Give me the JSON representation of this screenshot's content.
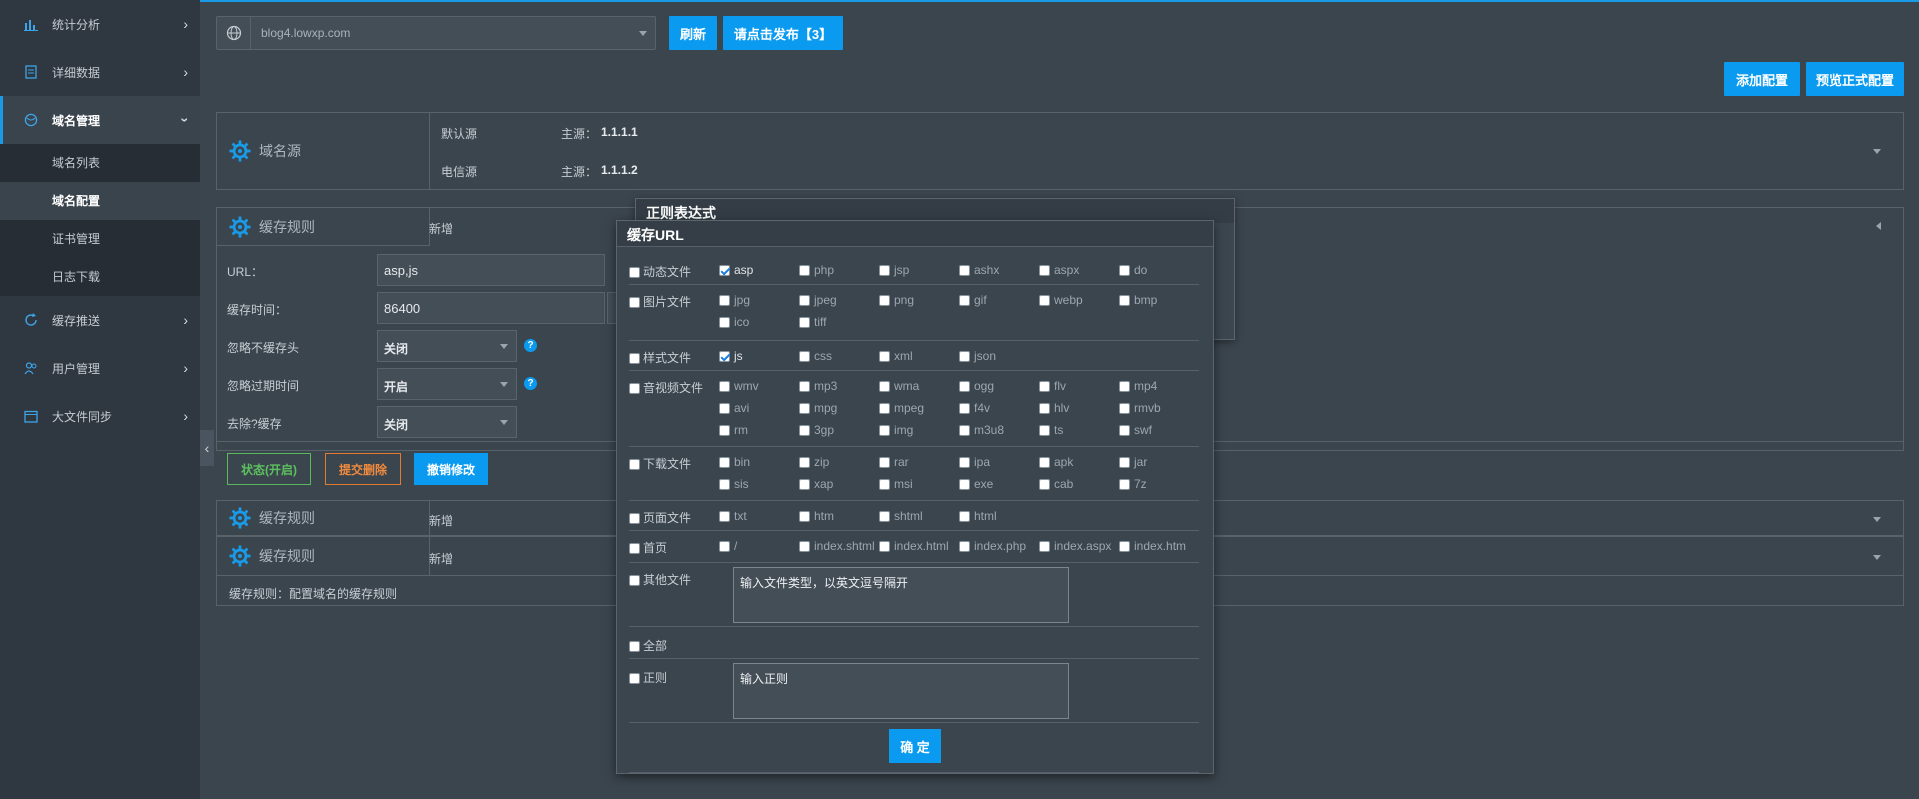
{
  "sidebar": {
    "items": [
      {
        "label": "统计分析",
        "icon": "bar-chart-icon"
      },
      {
        "label": "详细数据",
        "icon": "document-icon"
      },
      {
        "label": "域名管理",
        "icon": "globe-icon"
      },
      {
        "label": "缓存推送",
        "icon": "refresh-icon"
      },
      {
        "label": "用户管理",
        "icon": "users-icon"
      },
      {
        "label": "大文件同步",
        "icon": "calendar-icon"
      }
    ],
    "sub_items": [
      "域名列表",
      "域名配置",
      "证书管理",
      "日志下载"
    ]
  },
  "toolbar": {
    "domain": "blog4.lowxp.com",
    "refresh": "刷新",
    "publish": "请点击发布【3】",
    "add_config": "添加配置",
    "preview_config": "预览正式配置"
  },
  "origin_panel": {
    "title": "域名源",
    "rows": [
      {
        "name": "默认源",
        "key": "主源：",
        "value": "1.1.1.1"
      },
      {
        "name": "电信源",
        "key": "主源：",
        "value": "1.1.1.2"
      }
    ]
  },
  "cache_rule_1": {
    "title": "缓存规则",
    "action": "新增",
    "url_label": "URL：",
    "url_value": "asp,js",
    "time_label": "缓存时间：",
    "time_value": "86400",
    "ignore_nocache_label": "忽略不缓存头",
    "ignore_nocache_value": "关闭",
    "ignore_expire_label": "忽略过期时间",
    "ignore_expire_value": "开启",
    "remove_q_label": "去除?缓存",
    "remove_q_value": "关闭",
    "status_btn": "状态(开启)",
    "delete_btn": "提交删除",
    "undo_btn": "撤销修改",
    "help": "?"
  },
  "cache_rule_2": {
    "title": "缓存规则",
    "action": "新增"
  },
  "cache_rule_3": {
    "title": "缓存规则",
    "action": "新增"
  },
  "footer_note": "缓存规则：配置域名的缓存规则",
  "regex_popup": {
    "title": "正则表达式"
  },
  "cache_url_popup": {
    "title": "缓存URL",
    "groups": [
      {
        "label": "动态文件",
        "options": [
          "asp",
          "php",
          "jsp",
          "ashx",
          "aspx",
          "do"
        ],
        "checked": [
          "asp"
        ]
      },
      {
        "label": "图片文件",
        "options": [
          "jpg",
          "jpeg",
          "png",
          "gif",
          "webp",
          "bmp",
          "ico",
          "tiff"
        ],
        "checked": []
      },
      {
        "label": "样式文件",
        "options": [
          "js",
          "css",
          "xml",
          "json"
        ],
        "checked": [
          "js"
        ]
      },
      {
        "label": "音视频文件",
        "options": [
          "wmv",
          "mp3",
          "wma",
          "ogg",
          "flv",
          "mp4",
          "avi",
          "mpg",
          "mpeg",
          "f4v",
          "hlv",
          "rmvb",
          "rm",
          "3gp",
          "img",
          "m3u8",
          "ts",
          "swf"
        ],
        "checked": []
      },
      {
        "label": "下载文件",
        "options": [
          "bin",
          "zip",
          "rar",
          "ipa",
          "apk",
          "jar",
          "sis",
          "xap",
          "msi",
          "exe",
          "cab",
          "7z"
        ],
        "checked": []
      },
      {
        "label": "页面文件",
        "options": [
          "txt",
          "htm",
          "shtml",
          "html"
        ],
        "checked": []
      },
      {
        "label": "首页",
        "options": [
          "/",
          "index.shtml",
          "index.html",
          "index.php",
          "index.aspx",
          "index.htm"
        ],
        "checked": []
      }
    ],
    "other_label": "其他文件",
    "other_placeholder": "输入文件类型，以英文逗号隔开",
    "all_label": "全部",
    "regex_label": "正则",
    "regex_placeholder": "输入正则",
    "confirm": "确 定"
  }
}
